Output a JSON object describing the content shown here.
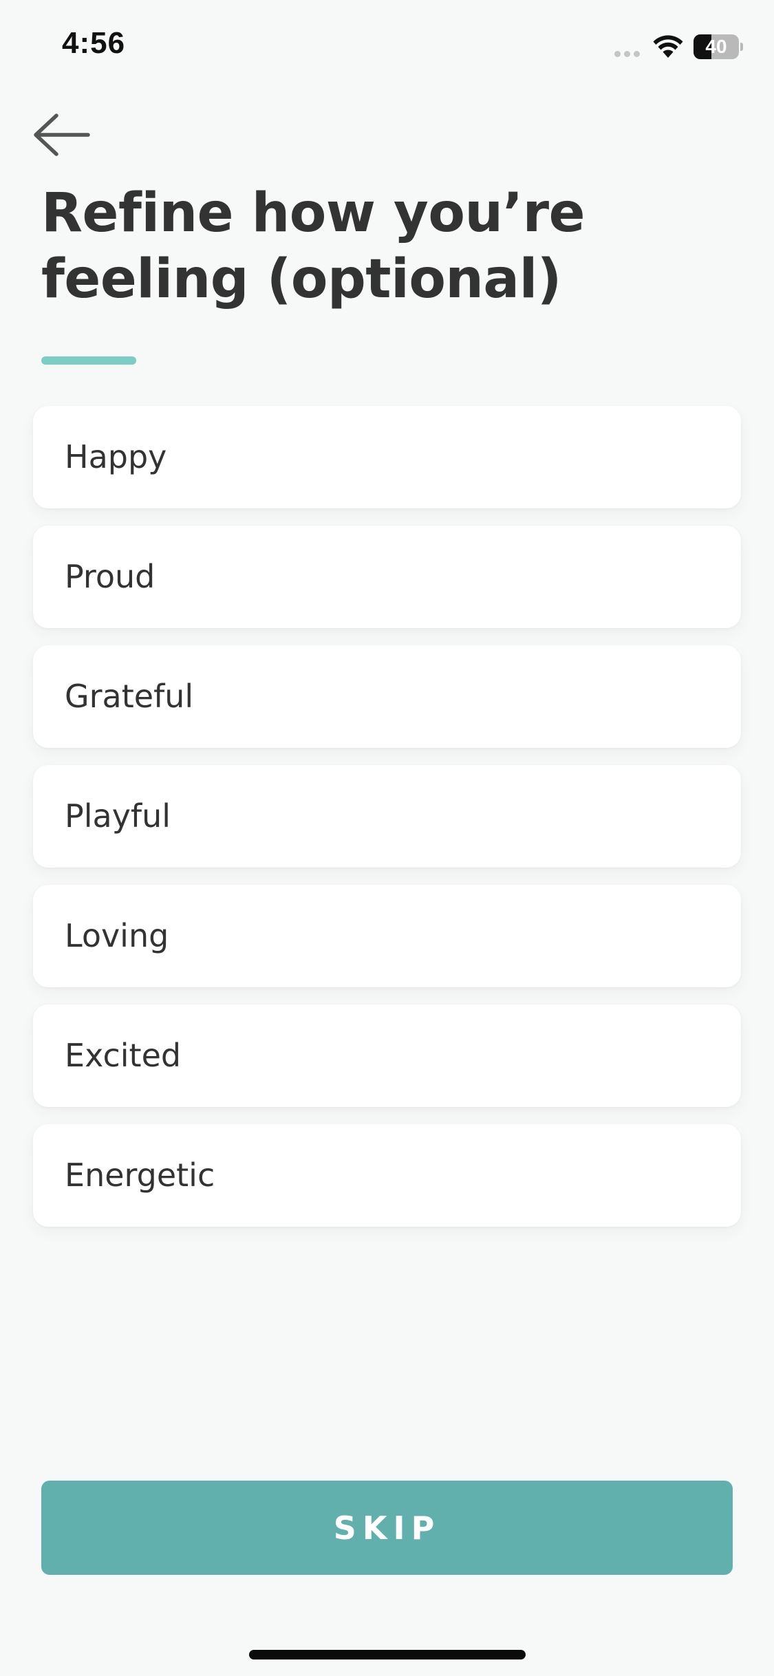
{
  "status_bar": {
    "time": "4:56",
    "battery_level": "40",
    "battery_fraction": 0.4
  },
  "back_icon": "arrow-left-icon",
  "title": "Refine how you’re feeling (optional)",
  "accent_color": "#7dcdc6",
  "options": [
    {
      "label": "Happy"
    },
    {
      "label": "Proud"
    },
    {
      "label": "Grateful"
    },
    {
      "label": "Playful"
    },
    {
      "label": "Loving"
    },
    {
      "label": "Excited"
    },
    {
      "label": "Energetic"
    }
  ],
  "skip_button": {
    "label": "SKIP",
    "color": "#62b0ae"
  }
}
